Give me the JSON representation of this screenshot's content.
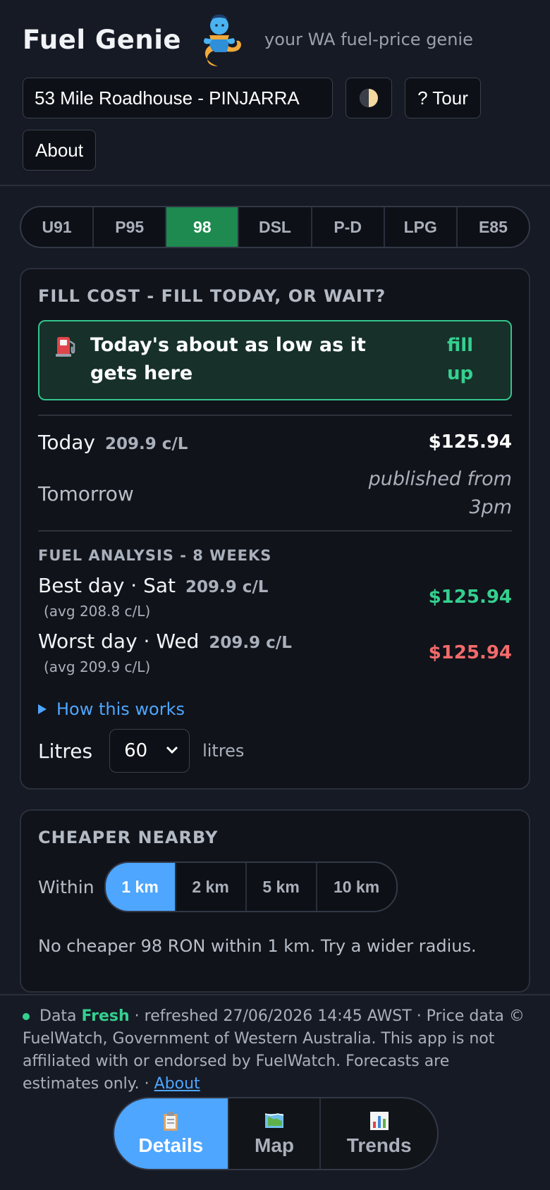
{
  "header": {
    "title": "Fuel Genie",
    "tagline": "your WA fuel-price genie",
    "station": "53 Mile Roadhouse - PINJARRA",
    "tour_label": "? Tour",
    "about_label": "About",
    "icons": {
      "logo": "genie-icon",
      "theme": "half-moon-icon"
    }
  },
  "fuel_tabs": [
    "U91",
    "P95",
    "98",
    "DSL",
    "P-D",
    "LPG",
    "E85"
  ],
  "fuel_active": "98",
  "fill_cost": {
    "title": "FILL COST - FILL TODAY, OR WAIT?",
    "banner_text": "Today's about as low as it gets here",
    "banner_action": "fill up",
    "today_label": "Today",
    "today_price": "209.9 c/L",
    "today_cost": "$125.94",
    "tomorrow_label": "Tomorrow",
    "tomorrow_note": "published from 3pm",
    "analysis_title": "FUEL ANALYSIS - 8 WEEKS",
    "best_label": "Best day · Sat",
    "best_price": "209.9 c/L",
    "best_avg": "(avg 208.8 c/L)",
    "best_cost": "$125.94",
    "worst_label": "Worst day · Wed",
    "worst_price": "209.9 c/L",
    "worst_avg": "(avg 209.9 c/L)",
    "worst_cost": "$125.94",
    "how_label": "How this works",
    "litres_label": "Litres",
    "litres_value": "60",
    "litres_unit": "litres"
  },
  "nearby": {
    "title": "CHEAPER NEARBY",
    "within_label": "Within",
    "radii": [
      "1 km",
      "2 km",
      "5 km",
      "10 km"
    ],
    "active_radius": "1 km",
    "message": "No cheaper 98 RON within 1 km. Try a wider radius."
  },
  "footer": {
    "data_label": "Data",
    "status": "Fresh",
    "refreshed": " · refreshed 27/06/2026 14:45 AWST · Price data © FuelWatch, Government of Western Australia. This app is not affiliated with or endorsed by FuelWatch. Forecasts are estimates only. · ",
    "about_link": "About"
  },
  "nav": {
    "details": "Details",
    "map": "Map",
    "trends": "Trends",
    "active": "Details"
  },
  "colors": {
    "accent": "#4ea6ff",
    "active_fuel": "#1e8a4f",
    "good": "#34d08f",
    "bad": "#f26b6b"
  }
}
